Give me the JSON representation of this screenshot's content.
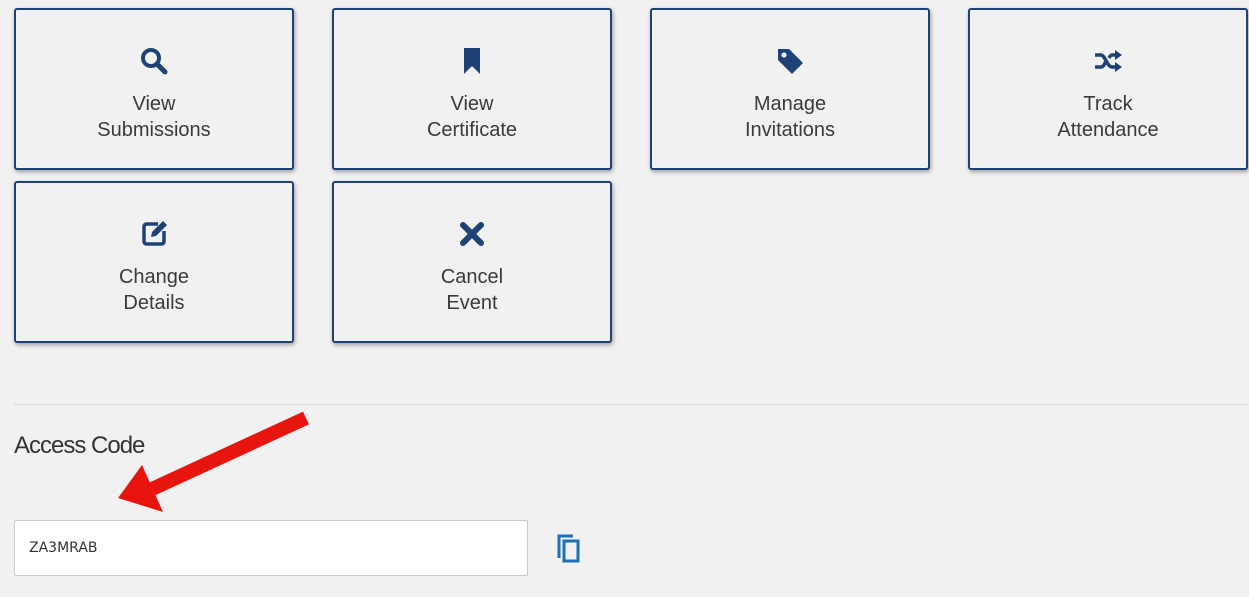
{
  "tiles": [
    {
      "label": "View\nSubmissions",
      "icon": "search-icon"
    },
    {
      "label": "View\nCertificate",
      "icon": "bookmark-icon"
    },
    {
      "label": "Manage\nInvitations",
      "icon": "tag-icon"
    },
    {
      "label": "Track\nAttendance",
      "icon": "shuffle-icon"
    },
    {
      "label": "Change\nDetails",
      "icon": "edit-icon"
    },
    {
      "label": "Cancel\nEvent",
      "icon": "close-icon"
    }
  ],
  "access": {
    "title": "Access Code",
    "code": "ZA3MRAB",
    "copy_icon": "copy-icon"
  },
  "colors": {
    "accent": "#1d4275",
    "annotation_arrow": "#e8150f"
  }
}
